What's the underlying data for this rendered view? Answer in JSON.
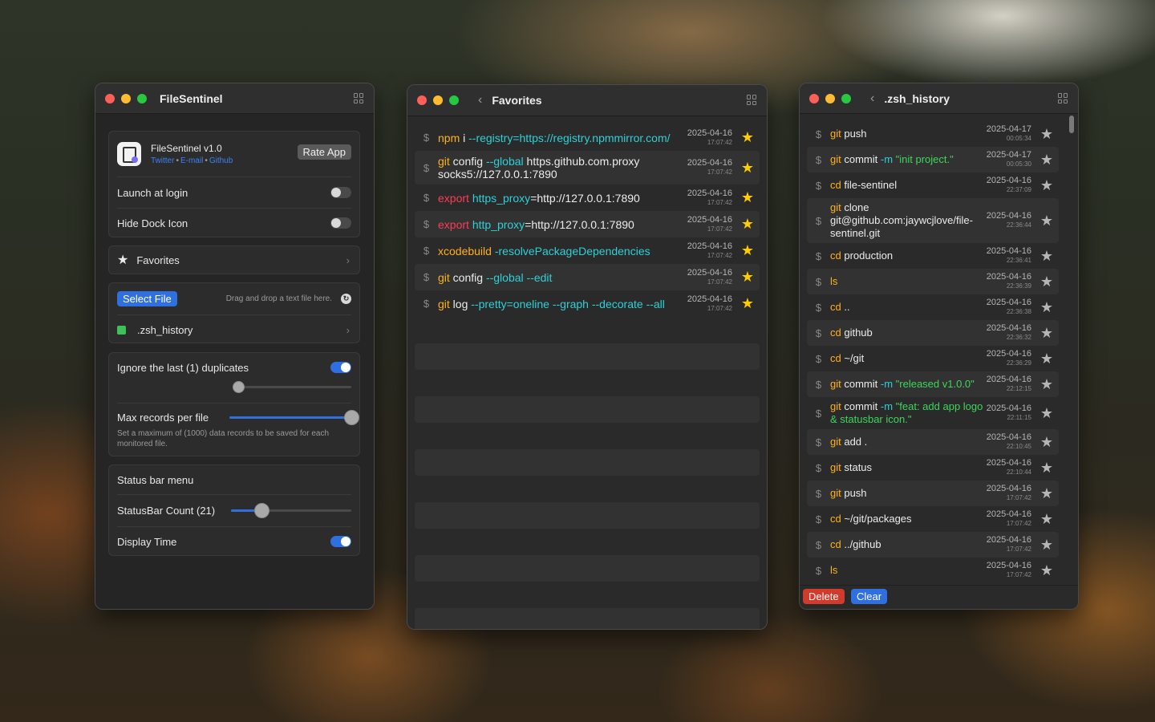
{
  "colors": {
    "accent": "#2f6fe0",
    "keyword": "#ffb020",
    "flag": "#2fd0d8",
    "export": "#ff3b55",
    "string": "#3cd65a",
    "favorite_star": "#ffcc00",
    "delete": "#d23a2c"
  },
  "settings_window": {
    "title": "FileSentinel",
    "app_name": "FileSentinel v1.0",
    "links": [
      "Twitter",
      "E-mail",
      "Github"
    ],
    "rate_label": "Rate App",
    "launch_at_login": {
      "label": "Launch at login",
      "on": false
    },
    "hide_dock_icon": {
      "label": "Hide Dock Icon",
      "on": false
    },
    "favorites_label": "Favorites",
    "select_file_label": "Select File",
    "drop_hint": "Drag and drop a text file here.",
    "watched_file": ".zsh_history",
    "ignore_duplicates": {
      "label": "Ignore the last (1) duplicates",
      "on": true,
      "slider": 0
    },
    "max_records": {
      "label": "Max records per file",
      "slider": 1.0,
      "description": "Set a maximum of (1000) data records to be saved for each monitored file."
    },
    "status_bar_menu_label": "Status bar menu",
    "statusbar_count": {
      "label": "StatusBar Count (21)",
      "slider": 0.25
    },
    "display_time": {
      "label": "Display Time",
      "on": true
    }
  },
  "favorites_window": {
    "title": "Favorites",
    "items": [
      {
        "tokens": [
          [
            "npm",
            "keyword"
          ],
          [
            " i ",
            "white"
          ],
          [
            "--registry=https://registry.npmmirror.com/",
            "flag"
          ]
        ],
        "date": "2025-04-16",
        "time": "17:07:42"
      },
      {
        "tokens": [
          [
            "git",
            "keyword"
          ],
          [
            " config ",
            "white"
          ],
          [
            "--global",
            "flag"
          ],
          [
            " https.github.com.proxy socks5://127.0.0.1:7890",
            "white"
          ]
        ],
        "date": "2025-04-16",
        "time": "17:07:42"
      },
      {
        "tokens": [
          [
            "export",
            "export"
          ],
          [
            " ",
            "white"
          ],
          [
            "https_proxy",
            "flag"
          ],
          [
            "=http://127.0.0.1:7890",
            "white"
          ]
        ],
        "date": "2025-04-16",
        "time": "17:07:42"
      },
      {
        "tokens": [
          [
            "export",
            "export"
          ],
          [
            " ",
            "white"
          ],
          [
            "http_proxy",
            "flag"
          ],
          [
            "=http://127.0.0.1:7890",
            "white"
          ]
        ],
        "date": "2025-04-16",
        "time": "17:07:42"
      },
      {
        "tokens": [
          [
            "xcodebuild",
            "keyword"
          ],
          [
            " ",
            "white"
          ],
          [
            "-resolvePackageDependencies",
            "flag"
          ]
        ],
        "date": "2025-04-16",
        "time": "17:07:42"
      },
      {
        "tokens": [
          [
            "git",
            "keyword"
          ],
          [
            " config ",
            "white"
          ],
          [
            "--global",
            "flag"
          ],
          [
            " ",
            "white"
          ],
          [
            "--edit",
            "flag"
          ]
        ],
        "date": "2025-04-16",
        "time": "17:07:42"
      },
      {
        "tokens": [
          [
            "git",
            "keyword"
          ],
          [
            " log ",
            "white"
          ],
          [
            "--pretty=oneline",
            "flag"
          ],
          [
            " ",
            "white"
          ],
          [
            "--graph",
            "flag"
          ],
          [
            " ",
            "white"
          ],
          [
            "--decorate",
            "flag"
          ],
          [
            " ",
            "white"
          ],
          [
            "--all",
            "flag"
          ]
        ],
        "date": "2025-04-16",
        "time": "17:07:42"
      }
    ]
  },
  "history_window": {
    "title": ".zsh_history",
    "delete_label": "Delete",
    "clear_label": "Clear",
    "items": [
      {
        "tokens": [
          [
            "git",
            "keyword"
          ],
          [
            " push",
            "white"
          ]
        ],
        "date": "2025-04-17",
        "time": "00:05:34"
      },
      {
        "tokens": [
          [
            "git",
            "keyword"
          ],
          [
            " commit ",
            "white"
          ],
          [
            "-m",
            "flag"
          ],
          [
            " ",
            "white"
          ],
          [
            "\"init project.\"",
            "string"
          ]
        ],
        "date": "2025-04-17",
        "time": "00:05:30"
      },
      {
        "tokens": [
          [
            "cd",
            "keyword"
          ],
          [
            " file-sentinel",
            "white"
          ]
        ],
        "date": "2025-04-16",
        "time": "22:37:09"
      },
      {
        "tokens": [
          [
            "git",
            "keyword"
          ],
          [
            " clone git@github.com:jaywcjlove/file-sentinel.git",
            "white"
          ]
        ],
        "date": "2025-04-16",
        "time": "22:36:44"
      },
      {
        "tokens": [
          [
            "cd",
            "keyword"
          ],
          [
            " production",
            "white"
          ]
        ],
        "date": "2025-04-16",
        "time": "22:36:41"
      },
      {
        "tokens": [
          [
            "ls",
            "keyword"
          ]
        ],
        "date": "2025-04-16",
        "time": "22:36:39"
      },
      {
        "tokens": [
          [
            "cd",
            "keyword"
          ],
          [
            " ..",
            "white"
          ]
        ],
        "date": "2025-04-16",
        "time": "22:36:38"
      },
      {
        "tokens": [
          [
            "cd",
            "keyword"
          ],
          [
            " github",
            "white"
          ]
        ],
        "date": "2025-04-16",
        "time": "22:36:32"
      },
      {
        "tokens": [
          [
            "cd",
            "keyword"
          ],
          [
            " ~/git",
            "white"
          ]
        ],
        "date": "2025-04-16",
        "time": "22:36:29"
      },
      {
        "tokens": [
          [
            "git",
            "keyword"
          ],
          [
            " commit ",
            "white"
          ],
          [
            "-m",
            "flag"
          ],
          [
            " ",
            "white"
          ],
          [
            "\"released v1.0.0\"",
            "string"
          ]
        ],
        "date": "2025-04-16",
        "time": "22:12:15"
      },
      {
        "tokens": [
          [
            "git",
            "keyword"
          ],
          [
            " commit ",
            "white"
          ],
          [
            "-m",
            "flag"
          ],
          [
            " ",
            "white"
          ],
          [
            "\"feat: add app logo & statusbar icon.\"",
            "string"
          ]
        ],
        "date": "2025-04-16",
        "time": "22:11:15"
      },
      {
        "tokens": [
          [
            "git",
            "keyword"
          ],
          [
            " add .",
            "white"
          ]
        ],
        "date": "2025-04-16",
        "time": "22:10:45"
      },
      {
        "tokens": [
          [
            "git",
            "keyword"
          ],
          [
            " status",
            "white"
          ]
        ],
        "date": "2025-04-16",
        "time": "22:10:44"
      },
      {
        "tokens": [
          [
            "git",
            "keyword"
          ],
          [
            " push",
            "white"
          ]
        ],
        "date": "2025-04-16",
        "time": "17:07:42"
      },
      {
        "tokens": [
          [
            "cd",
            "keyword"
          ],
          [
            " ~/git/packages",
            "white"
          ]
        ],
        "date": "2025-04-16",
        "time": "17:07:42"
      },
      {
        "tokens": [
          [
            "cd",
            "keyword"
          ],
          [
            " ../github",
            "white"
          ]
        ],
        "date": "2025-04-16",
        "time": "17:07:42"
      },
      {
        "tokens": [
          [
            "ls",
            "keyword"
          ]
        ],
        "date": "2025-04-16",
        "time": "17:07:42"
      }
    ]
  }
}
